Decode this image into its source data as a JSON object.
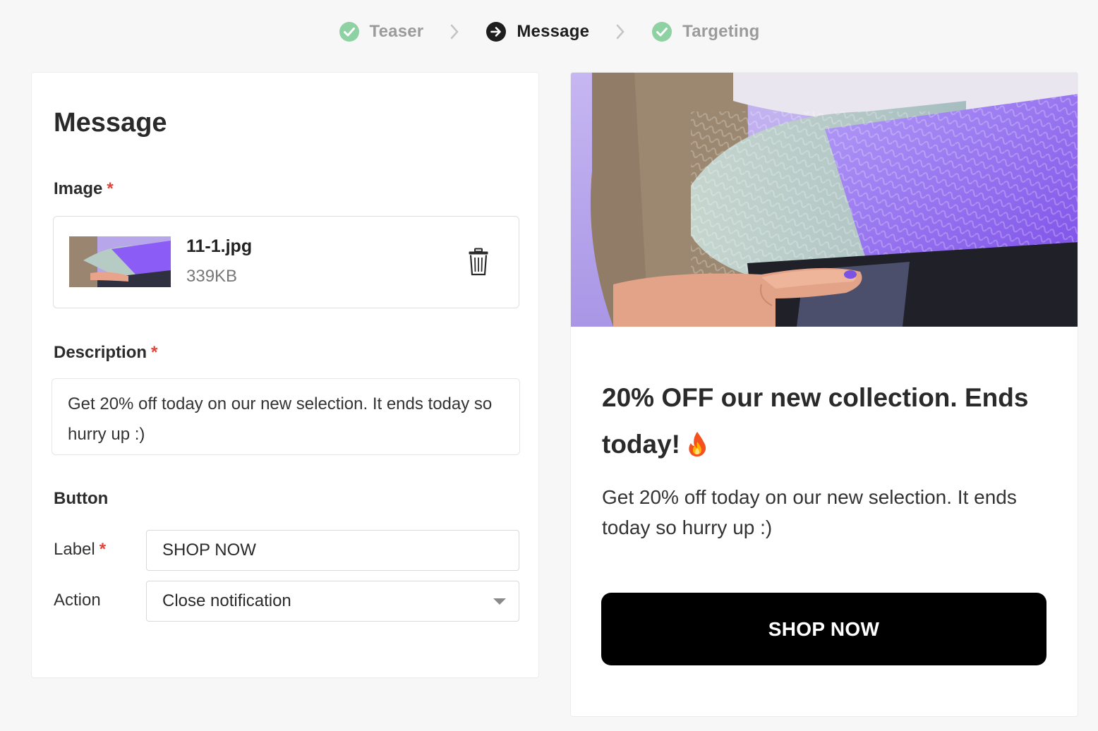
{
  "stepper": {
    "steps": [
      {
        "label": "Teaser",
        "state": "done"
      },
      {
        "label": "Message",
        "state": "active"
      },
      {
        "label": "Targeting",
        "state": "done"
      }
    ]
  },
  "form": {
    "title": "Message",
    "image": {
      "label": "Image",
      "required_mark": "*",
      "file_name": "11-1.jpg",
      "file_size": "339KB"
    },
    "description": {
      "label": "Description",
      "required_mark": "*",
      "value": "Get 20% off today on our new selection. It ends today so hurry up :)"
    },
    "button": {
      "section_label": "Button",
      "label_field": {
        "label": "Label",
        "required_mark": "*",
        "value": "SHOP NOW"
      },
      "action_field": {
        "label": "Action",
        "value": "Close notification"
      }
    }
  },
  "preview": {
    "title": "20% OFF our new collection. Ends today!",
    "description": "Get 20% off today on our new selection. It ends today so hurry up :)",
    "cta_label": "SHOP NOW"
  },
  "colors": {
    "check_green": "#8ed1a3",
    "active_dark": "#1e1e1e",
    "required_red": "#e0453b",
    "cta_black": "#000000",
    "sweater_purple": "#8b5cf6"
  },
  "icons": [
    "check-circle-icon",
    "arrow-right-circle-icon",
    "chevron-right-icon",
    "trash-icon",
    "chevron-down-icon",
    "fire-emoji-icon"
  ]
}
